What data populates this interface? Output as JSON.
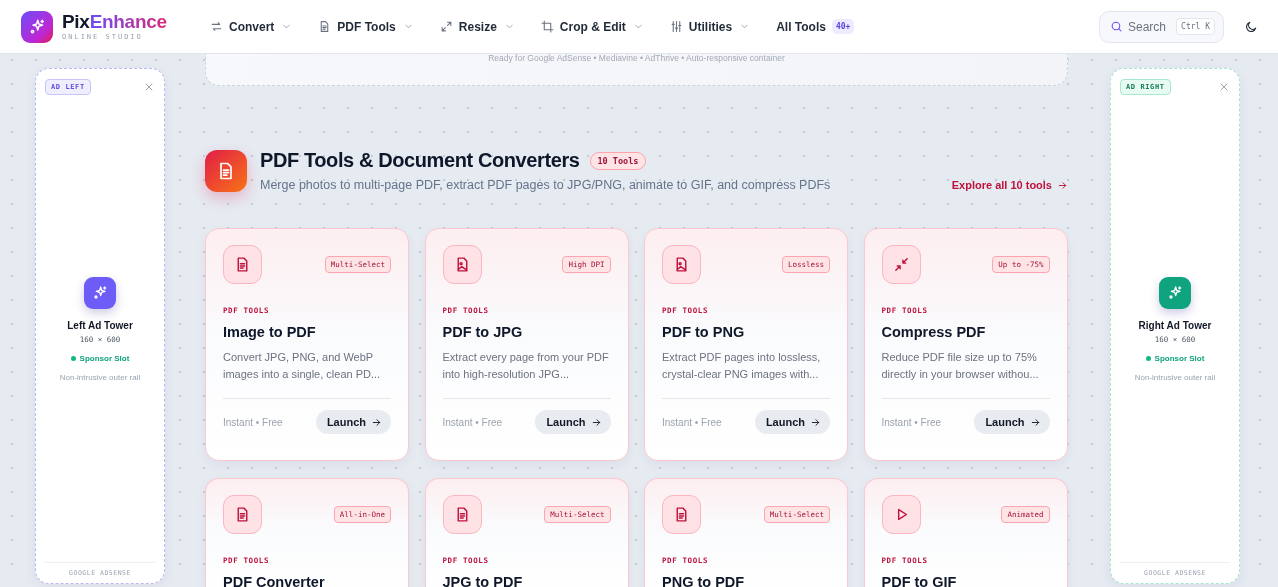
{
  "brand": {
    "name_part_1": "Pix",
    "name_part_2": "Enhance",
    "tagline": "ONLINE STUDIO"
  },
  "nav": [
    {
      "label": "Convert",
      "kind": "dropdown"
    },
    {
      "label": "PDF Tools",
      "kind": "dropdown"
    },
    {
      "label": "Resize",
      "kind": "dropdown"
    },
    {
      "label": "Crop & Edit",
      "kind": "dropdown"
    },
    {
      "label": "Utilities",
      "kind": "dropdown"
    },
    {
      "label": "All Tools",
      "kind": "badge",
      "badge": "40+"
    }
  ],
  "search": {
    "placeholder": "Search",
    "shortcut": "Ctrl K"
  },
  "top_banner": {
    "text": "Ready for Google AdSense • Mediavine • AdThrive • Auto-responsive container"
  },
  "left_rail": {
    "badge": "AD LEFT",
    "title": "Left Ad Tower",
    "size": "160 × 600",
    "status": "Sponsor Slot",
    "note": "Non-intrusive outer rail",
    "footer": "GOOGLE ADSENSE",
    "color": "#6d5df6"
  },
  "right_rail": {
    "badge": "AD RIGHT",
    "title": "Right Ad Tower",
    "size": "160 × 600",
    "status": "Sponsor Slot",
    "note": "Non-intrusive outer rail",
    "footer": "GOOGLE ADSENSE",
    "color": "#10a37f"
  },
  "section": {
    "title": "PDF Tools & Document Converters",
    "count": "10 Tools",
    "subtitle": "Merge photos to multi-page PDF, extract PDF pages to JPG/PNG, animate to GIF, and compress PDFs",
    "link": "Explore all 10 tools"
  },
  "cards": [
    {
      "kind": "document",
      "tag": "Multi-Select",
      "category": "PDF TOOLS",
      "title": "Image to PDF",
      "description": "Convert JPG, PNG, and WebP images into a single, clean PD...",
      "meta": "Instant • Free",
      "action": "Launch"
    },
    {
      "kind": "image",
      "tag": "High DPI",
      "category": "PDF TOOLS",
      "title": "PDF to JPG",
      "description": "Extract every page from your PDF into high-resolution JPG...",
      "meta": "Instant • Free",
      "action": "Launch"
    },
    {
      "kind": "image",
      "tag": "Lossless",
      "category": "PDF TOOLS",
      "title": "PDF to PNG",
      "description": "Extract PDF pages into lossless, crystal-clear PNG images with...",
      "meta": "Instant • Free",
      "action": "Launch"
    },
    {
      "kind": "compress",
      "tag": "Up to -75%",
      "category": "PDF TOOLS",
      "title": "Compress PDF",
      "description": "Reduce PDF file size up to 75% directly in your browser withou...",
      "meta": "Instant • Free",
      "action": "Launch"
    },
    {
      "kind": "document",
      "tag": "All-in-One",
      "category": "PDF TOOLS",
      "title": "PDF Converter"
    },
    {
      "kind": "document",
      "tag": "Multi-Select",
      "category": "PDF TOOLS",
      "title": "JPG to PDF"
    },
    {
      "kind": "document",
      "tag": "Multi-Select",
      "category": "PDF TOOLS",
      "title": "PNG to PDF"
    },
    {
      "kind": "animation",
      "tag": "Animated",
      "category": "PDF TOOLS",
      "title": "PDF to GIF"
    }
  ]
}
